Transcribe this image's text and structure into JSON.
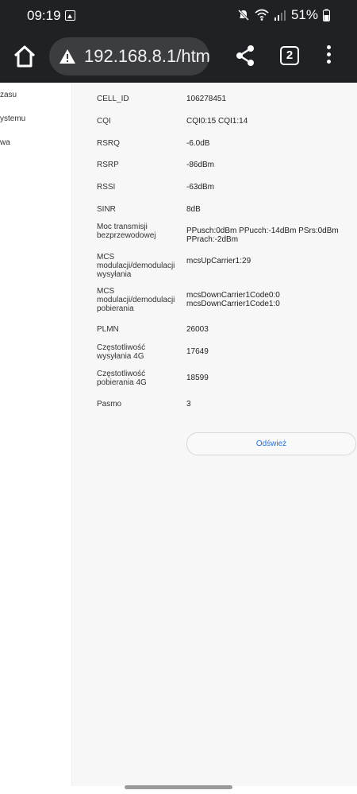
{
  "status": {
    "time": "09:19",
    "battery": "51%",
    "icons": [
      "image-icon",
      "mute-icon",
      "wifi-icon",
      "signal-icon",
      "battery-icon"
    ]
  },
  "browser": {
    "url": "192.168.8.1/htm",
    "tab_count": "2",
    "icons": [
      "home-icon",
      "warning-icon",
      "share-icon",
      "tabs-icon",
      "menu-icon"
    ]
  },
  "sidebar": {
    "items": [
      {
        "label": "zasu"
      },
      {
        "label": "ystemu"
      },
      {
        "label": "wa"
      }
    ]
  },
  "info": {
    "rows": [
      {
        "label": "CELL_ID",
        "value": "106278451"
      },
      {
        "label": "CQI",
        "value": "CQI0:15 CQI1:14"
      },
      {
        "label": "RSRQ",
        "value": "-6.0dB"
      },
      {
        "label": "RSRP",
        "value": "-86dBm"
      },
      {
        "label": "RSSI",
        "value": "-63dBm"
      },
      {
        "label": "SINR",
        "value": "8dB"
      },
      {
        "label": "Moc transmisji bezprzewodowej",
        "value": "PPusch:0dBm PPucch:-14dBm PSrs:0dBm PPrach:-2dBm"
      },
      {
        "label": "MCS modulacji/demodulacji wysyłania",
        "value": "mcsUpCarrier1:29"
      },
      {
        "label": "MCS modulacji/demodulacji pobierania",
        "value": "mcsDownCarrier1Code0:0 mcsDownCarrier1Code1:0"
      },
      {
        "label": "PLMN",
        "value": "26003"
      },
      {
        "label": "Częstotliwość wysyłania 4G",
        "value": "17649"
      },
      {
        "label": "Częstotliwość pobierania 4G",
        "value": "18599"
      },
      {
        "label": "Pasmo",
        "value": "3"
      }
    ],
    "refresh_label": "Odśwież"
  },
  "colors": {
    "chrome": "#202124",
    "url_pill": "#3c3d41",
    "accent": "#1a73e8"
  }
}
